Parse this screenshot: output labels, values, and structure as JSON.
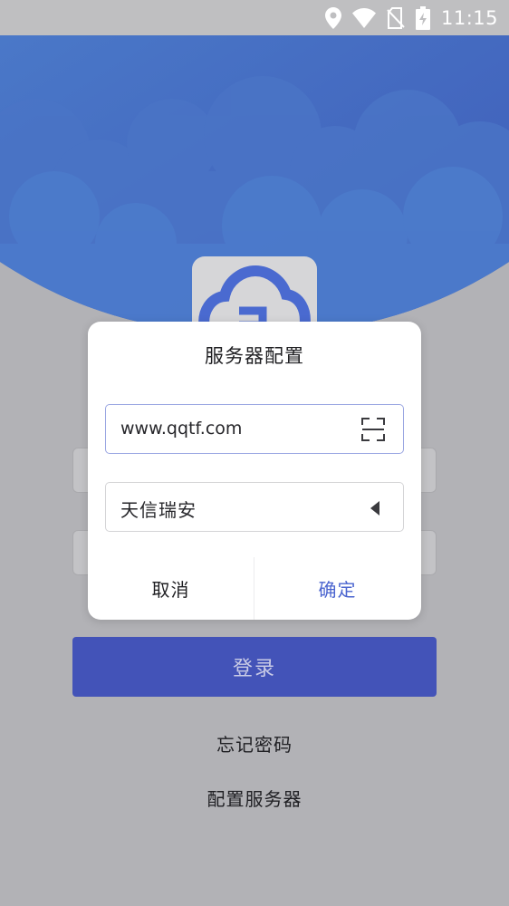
{
  "status_bar": {
    "time": "11:15",
    "icons": [
      "location-icon",
      "wifi-icon",
      "no-sim-icon",
      "battery-charging-icon"
    ]
  },
  "colors": {
    "header_blue": "#4469c4",
    "primary": "#4353b8",
    "confirm_text": "#4a64cf",
    "input_focus_border": "#9aa6e2"
  },
  "login": {
    "login_button": "登录",
    "forgot_password": "忘记密码",
    "config_server": "配置服务器"
  },
  "dialog": {
    "title": "服务器配置",
    "server_value": "www.qqtf.com",
    "company_selected": "天信瑞安",
    "cancel_label": "取消",
    "confirm_label": "确定"
  }
}
